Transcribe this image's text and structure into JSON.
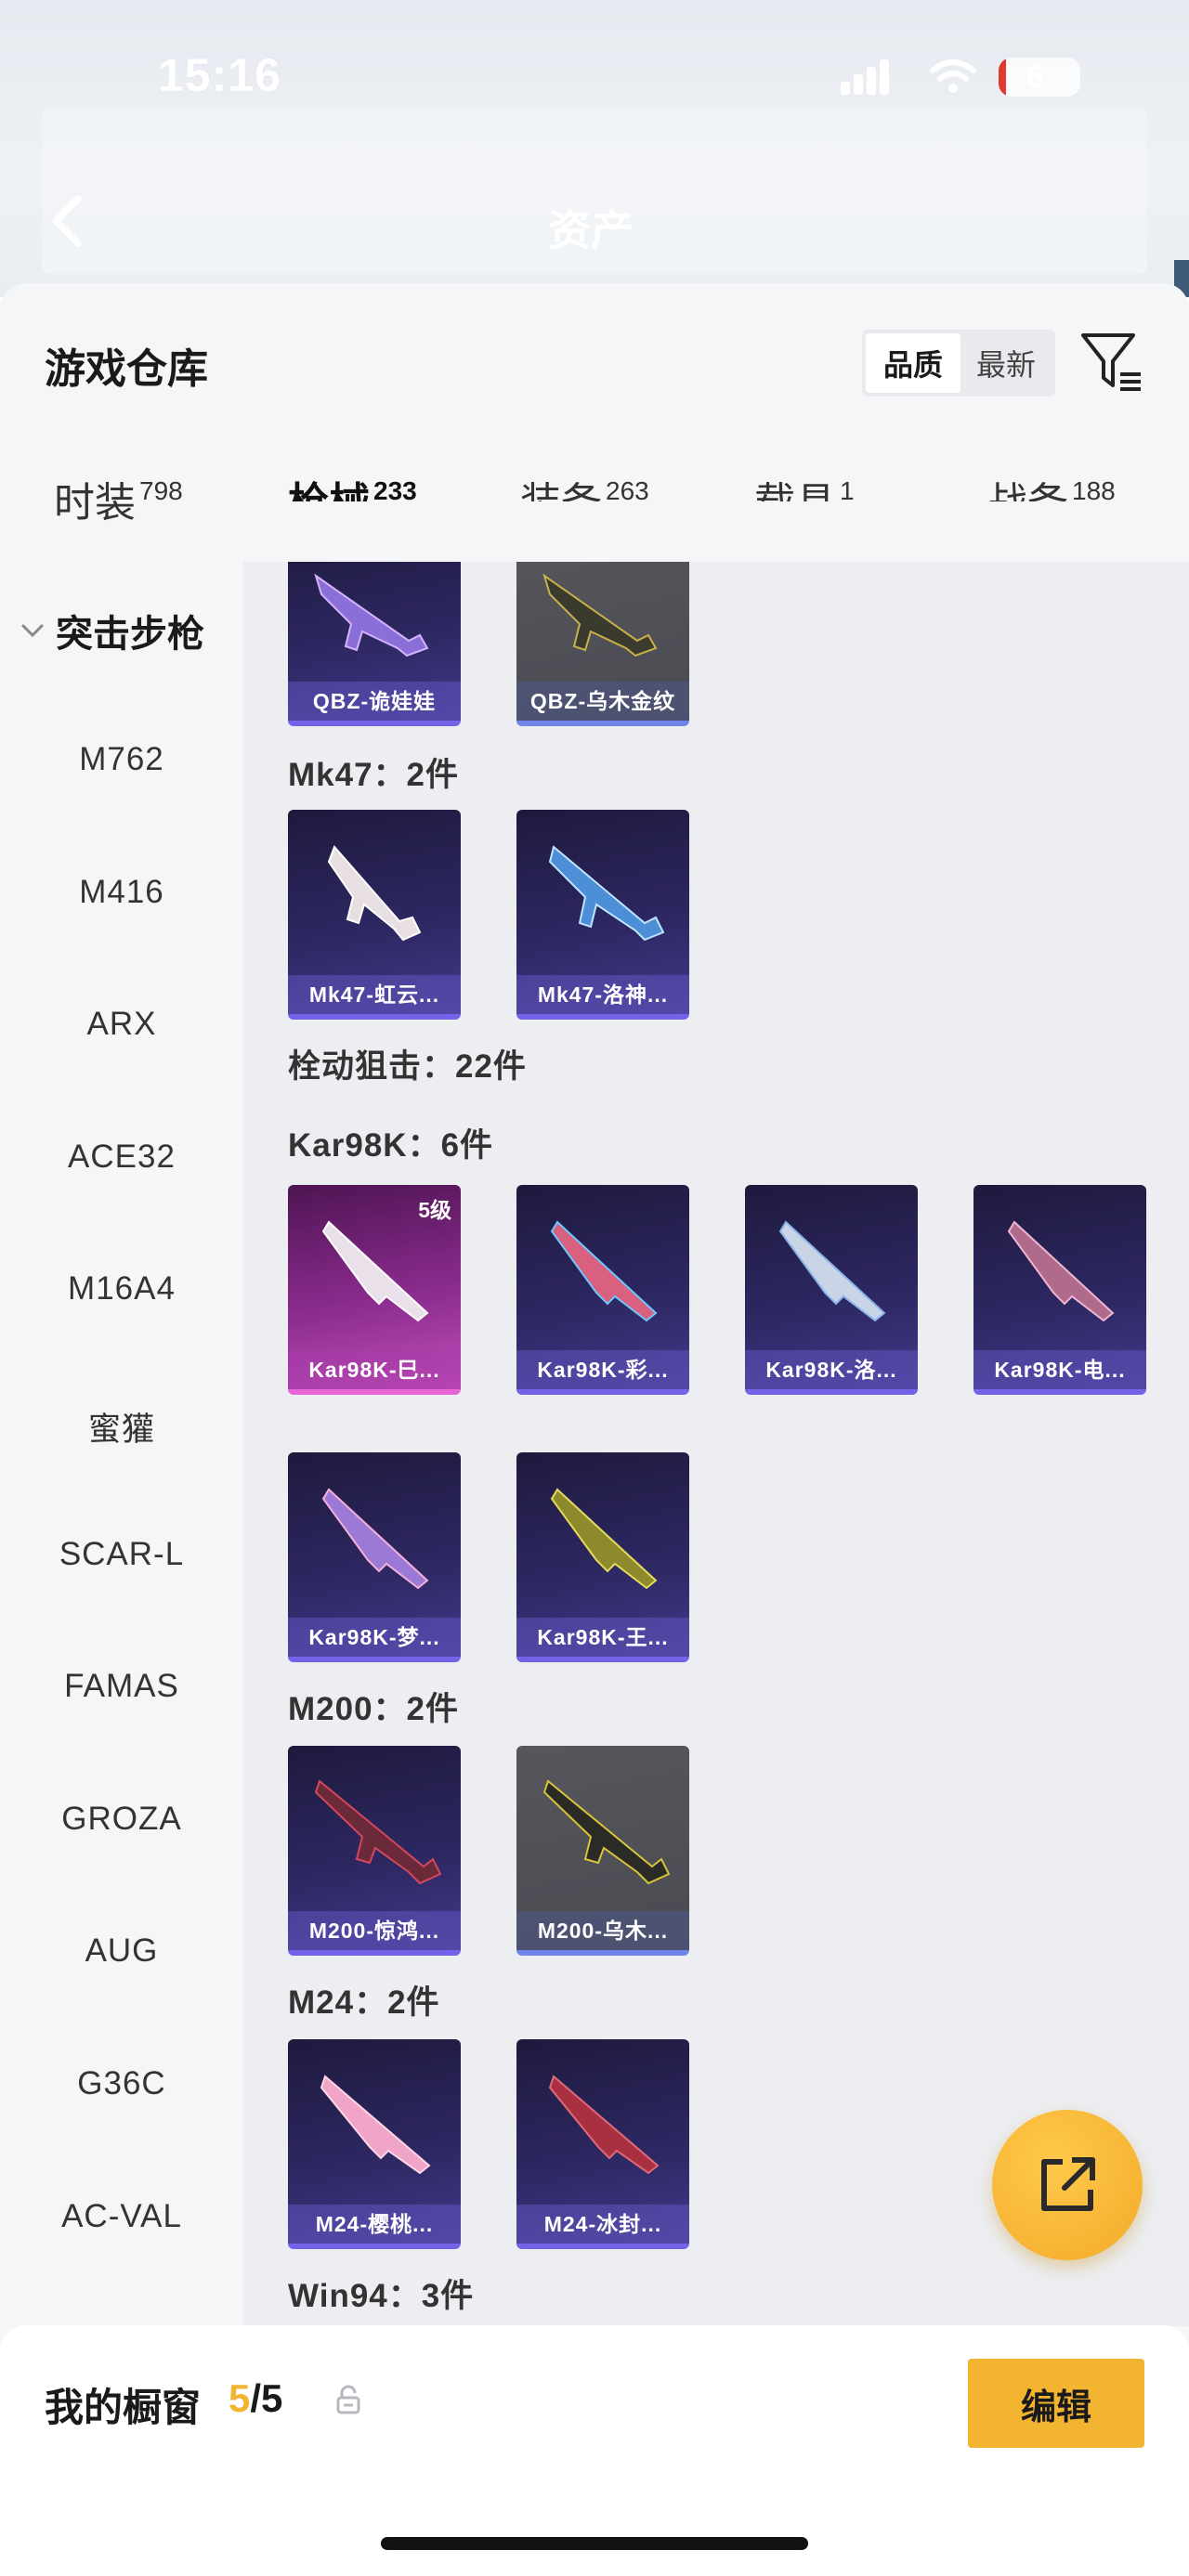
{
  "status_bar": {
    "time": "15:16",
    "battery": "6"
  },
  "top_nav": {
    "title": "资产"
  },
  "header": {
    "title": "游戏仓库",
    "sort_quality": "品质",
    "sort_newest": "最新"
  },
  "tabs": [
    {
      "label": "时装",
      "count": "798"
    },
    {
      "label": "枪械",
      "count": "233"
    },
    {
      "label": "装备",
      "count": "263"
    },
    {
      "label": "载具",
      "count": "1"
    },
    {
      "label": "战备",
      "count": "188"
    }
  ],
  "sidebar": {
    "category": "突击步枪",
    "items": [
      "M762",
      "M416",
      "ARX",
      "ACE32",
      "M16A4",
      "蜜獾",
      "SCAR-L",
      "FAMAS",
      "GROZA",
      "AUG",
      "G36C",
      "AC-VAL"
    ]
  },
  "sections": {
    "qbz": {
      "cards": [
        "QBZ-诡娃娃",
        "QBZ-乌木金纹"
      ]
    },
    "mk47": {
      "header": "Mk47：2件",
      "cards": [
        "Mk47-虹云...",
        "Mk47-洛神..."
      ]
    },
    "bolt": {
      "header": "栓动狙击：22件"
    },
    "kar98k": {
      "header": "Kar98K：6件",
      "level": "5级",
      "cards": [
        "Kar98K-巳...",
        "Kar98K-彩...",
        "Kar98K-洛...",
        "Kar98K-电...",
        "Kar98K-梦...",
        "Kar98K-王..."
      ]
    },
    "m200": {
      "header": "M200：2件",
      "cards": [
        "M200-惊鸿...",
        "M200-乌木..."
      ]
    },
    "m24": {
      "header": "M24：2件",
      "cards": [
        "M24-樱桃...",
        "M24-冰封..."
      ]
    },
    "win94": {
      "header": "Win94：3件"
    }
  },
  "bottom_bar": {
    "title": "我的橱窗",
    "count_current": "5",
    "count_total": "/5",
    "edit_label": "编辑"
  },
  "colors": {
    "accent": "#f2b431",
    "card_purple": "#2e2864",
    "card_pink": "#8a2b8e",
    "card_gray": "#4e4e56"
  }
}
